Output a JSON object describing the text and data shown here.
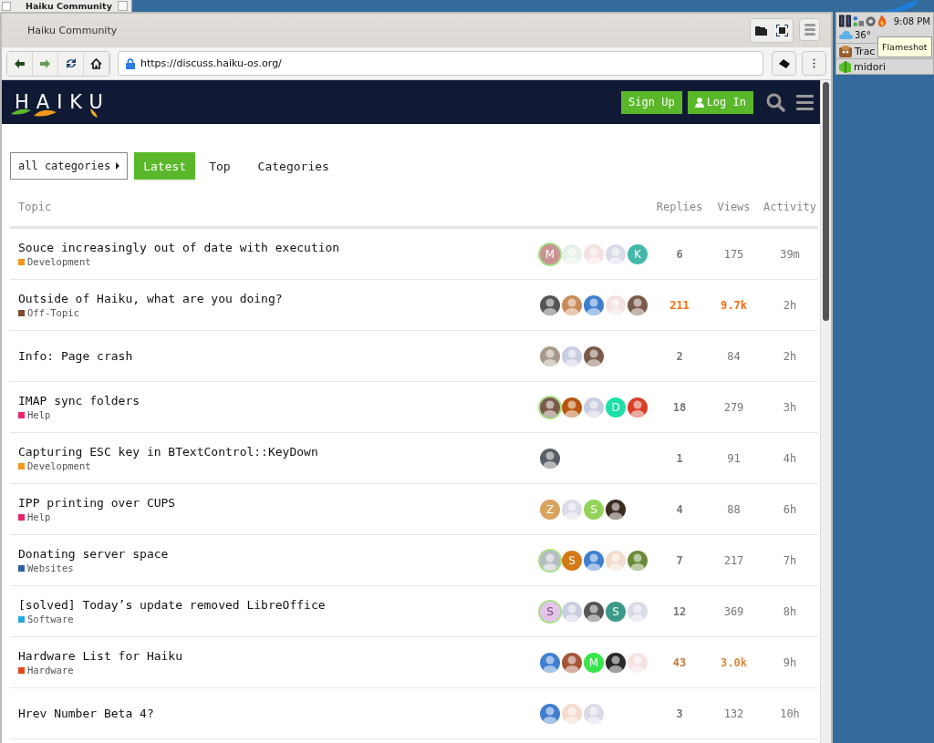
{
  "window_tab": {
    "title": "Haiku Community"
  },
  "browser": {
    "title": "Haiku Community",
    "url": "https://discuss.haiku-os.org/"
  },
  "site_header": {
    "logo": "HAIKU",
    "buttons": [
      {
        "label": "Sign Up",
        "kind": "signup"
      },
      {
        "label": "Log In",
        "kind": "login"
      }
    ]
  },
  "nav": {
    "category_filter": "all categories",
    "tabs": [
      {
        "label": "Latest",
        "selected": true
      },
      {
        "label": "Top",
        "selected": false
      },
      {
        "label": "Categories",
        "selected": false
      }
    ]
  },
  "table": {
    "columns": [
      "Topic",
      "Replies",
      "Views",
      "Activity"
    ],
    "rows": [
      {
        "title": "Souce increasingly out of date with execution",
        "category": {
          "name": "Development",
          "color": "#f7941d"
        },
        "avatars": [
          {
            "kind": "letter",
            "letter": "M",
            "color": "#c99393",
            "highlighted": true
          },
          {
            "kind": "image",
            "color": "#e6efe8",
            "highlighted": false
          },
          {
            "kind": "image",
            "color": "#f4e2e2",
            "highlighted": false
          },
          {
            "kind": "image",
            "color": "#d9dbe6",
            "highlighted": false
          },
          {
            "kind": "letter",
            "letter": "K",
            "color": "#45b8ac",
            "highlighted": false
          }
        ],
        "replies": {
          "text": "6",
          "color": "#777777"
        },
        "views": {
          "text": "175",
          "color": "#777777"
        },
        "activity": "39m"
      },
      {
        "title": "Outside of Haiku, what are you doing?",
        "category": {
          "name": "Off-Topic",
          "color": "#7d4e32"
        },
        "avatars": [
          {
            "kind": "image",
            "color": "#555555",
            "highlighted": false
          },
          {
            "kind": "image",
            "color": "#c98a5a",
            "highlighted": false
          },
          {
            "kind": "image",
            "color": "#3f7fcf",
            "highlighted": false
          },
          {
            "kind": "image",
            "color": "#f4e2e2",
            "highlighted": false
          },
          {
            "kind": "image",
            "color": "#7a5a4a",
            "highlighted": false
          }
        ],
        "replies": {
          "text": "211",
          "color": "#f96d0c"
        },
        "views": {
          "text": "9.7k",
          "color": "#f96d0c"
        },
        "activity": "2h"
      },
      {
        "title": "Info: Page crash",
        "avatars": [
          {
            "kind": "image",
            "color": "#a89a8a",
            "highlighted": false
          },
          {
            "kind": "image",
            "color": "#c9cde0",
            "highlighted": false
          },
          {
            "kind": "image",
            "color": "#7a5a4a",
            "highlighted": false
          }
        ],
        "replies": {
          "text": "2",
          "color": "#777777"
        },
        "views": {
          "text": "84",
          "color": "#777777"
        },
        "activity": "2h"
      },
      {
        "title": "IMAP sync folders",
        "category": {
          "name": "Help",
          "color": "#e8246d"
        },
        "avatars": [
          {
            "kind": "image",
            "color": "#7a5a4a",
            "highlighted": true
          },
          {
            "kind": "image",
            "color": "#b8560f",
            "highlighted": false
          },
          {
            "kind": "image",
            "color": "#c9cde0",
            "highlighted": false
          },
          {
            "kind": "letter",
            "letter": "D",
            "color": "#1de0a8",
            "highlighted": false
          },
          {
            "kind": "image",
            "color": "#d8402a",
            "highlighted": false
          }
        ],
        "replies": {
          "text": "18",
          "color": "#777777"
        },
        "views": {
          "text": "279",
          "color": "#777777"
        },
        "activity": "3h"
      },
      {
        "title": "Capturing ESC key in BTextControl::KeyDown",
        "category": {
          "name": "Development",
          "color": "#f7941d"
        },
        "avatars": [
          {
            "kind": "image",
            "color": "#5a5e66",
            "highlighted": false
          }
        ],
        "replies": {
          "text": "1",
          "color": "#777777"
        },
        "views": {
          "text": "91",
          "color": "#777777"
        },
        "activity": "4h"
      },
      {
        "title": "IPP printing over CUPS",
        "category": {
          "name": "Help",
          "color": "#e8246d"
        },
        "avatars": [
          {
            "kind": "letter",
            "letter": "Z",
            "color": "#d9a35e",
            "highlighted": false
          },
          {
            "kind": "image",
            "color": "#d9dbe6",
            "highlighted": false
          },
          {
            "kind": "letter",
            "letter": "S",
            "color": "#93d35a",
            "highlighted": false
          },
          {
            "kind": "image",
            "color": "#3a2a20",
            "highlighted": false
          }
        ],
        "replies": {
          "text": "4",
          "color": "#777777"
        },
        "views": {
          "text": "88",
          "color": "#777777"
        },
        "activity": "6h"
      },
      {
        "title": "Donating server space",
        "category": {
          "name": "Websites",
          "color": "#2e5fa8"
        },
        "avatars": [
          {
            "kind": "image",
            "color": "#b8bcc4",
            "highlighted": true
          },
          {
            "kind": "letter",
            "letter": "S",
            "color": "#d27a16",
            "highlighted": false
          },
          {
            "kind": "image",
            "color": "#3f7fcf",
            "highlighted": false
          },
          {
            "kind": "image",
            "color": "#f3dccd",
            "highlighted": false
          },
          {
            "kind": "image",
            "color": "#6a8a3a",
            "highlighted": false
          }
        ],
        "replies": {
          "text": "7",
          "color": "#777777"
        },
        "views": {
          "text": "217",
          "color": "#777777"
        },
        "activity": "7h"
      },
      {
        "title": "[solved] Today’s update removed LibreOffice",
        "category": {
          "name": "Software",
          "color": "#29a8e0"
        },
        "avatars": [
          {
            "kind": "letter",
            "letter": "S",
            "color": "#e5c4ec",
            "highlighted": true
          },
          {
            "kind": "image",
            "color": "#c9cde0",
            "highlighted": false
          },
          {
            "kind": "image",
            "color": "#555555",
            "highlighted": false
          },
          {
            "kind": "letter",
            "letter": "S",
            "color": "#3a9a87",
            "highlighted": false
          },
          {
            "kind": "image",
            "color": "#d9dbe6",
            "highlighted": false
          }
        ],
        "replies": {
          "text": "12",
          "color": "#777777"
        },
        "views": {
          "text": "369",
          "color": "#777777"
        },
        "activity": "8h"
      },
      {
        "title": "Hardware List for Haiku",
        "category": {
          "name": "Hardware",
          "color": "#e2491b"
        },
        "avatars": [
          {
            "kind": "image",
            "color": "#3f7fcf",
            "highlighted": false
          },
          {
            "kind": "image",
            "color": "#a5553a",
            "highlighted": false
          },
          {
            "kind": "letter",
            "letter": "M",
            "color": "#38e54b",
            "highlighted": false
          },
          {
            "kind": "image",
            "color": "#2a2a2a",
            "highlighted": false
          },
          {
            "kind": "image",
            "color": "#f4e2e2",
            "highlighted": false
          }
        ],
        "replies": {
          "text": "43",
          "color": "#c07a3a"
        },
        "views": {
          "text": "3.0k",
          "color": "#e08a3a"
        },
        "activity": "9h"
      },
      {
        "title": "Hrev Number Beta 4?",
        "avatars": [
          {
            "kind": "image",
            "color": "#3f7fcf",
            "highlighted": false
          },
          {
            "kind": "image",
            "color": "#f3dccd",
            "highlighted": false
          },
          {
            "kind": "image",
            "color": "#d9dbe6",
            "highlighted": false
          }
        ],
        "replies": {
          "text": "3",
          "color": "#777777"
        },
        "views": {
          "text": "132",
          "color": "#777777"
        },
        "activity": "10h"
      }
    ]
  },
  "deskbar": {
    "clock": "9:08 PM",
    "temperature": "36°",
    "items": [
      {
        "label": "Trac",
        "kind": "tracker"
      },
      {
        "label": "midori",
        "kind": "midori"
      }
    ],
    "tooltip": "Flameshot"
  }
}
